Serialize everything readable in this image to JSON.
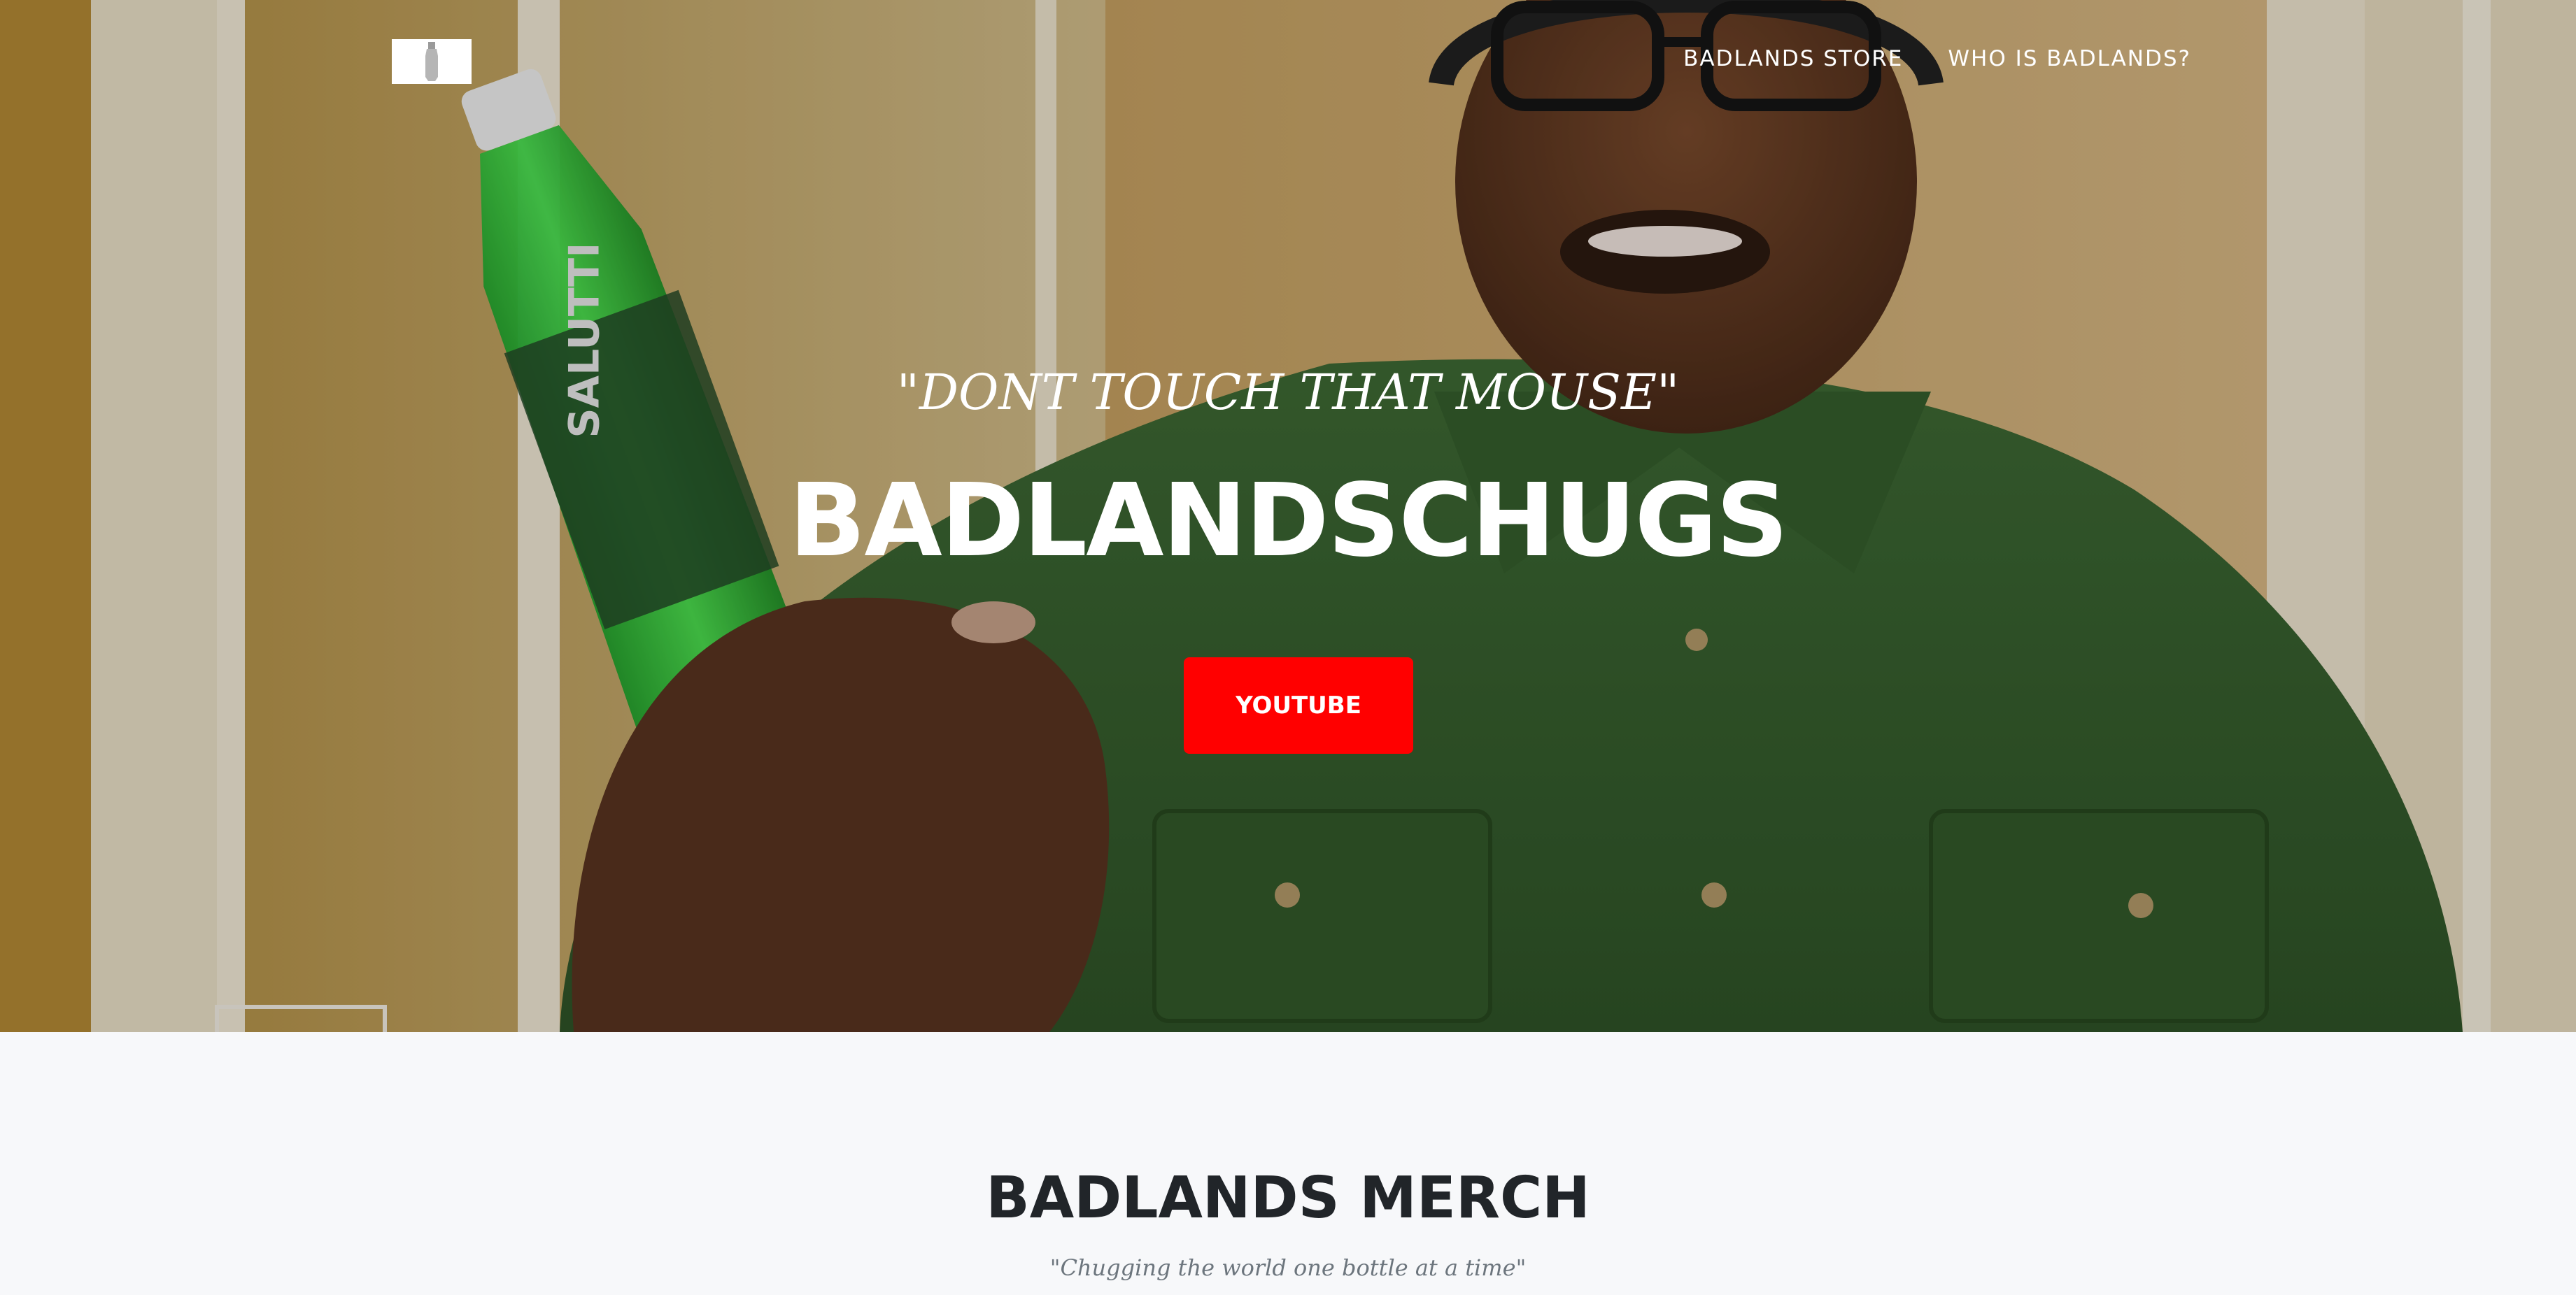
{
  "nav": {
    "items": [
      {
        "label": "BADLANDS STORE"
      },
      {
        "label": "WHO IS BADLANDS?"
      }
    ]
  },
  "hero": {
    "tagline": "\"DONT TOUCH THAT MOUSE\"",
    "headline": "BADLANDSCHUGS",
    "cta_label": "YOUTUBE",
    "cta_color": "#ff0000"
  },
  "merch": {
    "heading": "BADLANDS MERCH",
    "subheading": "\"Chugging the world one bottle at a time\""
  },
  "icons": {
    "logo": "bottle-logo-icon"
  }
}
